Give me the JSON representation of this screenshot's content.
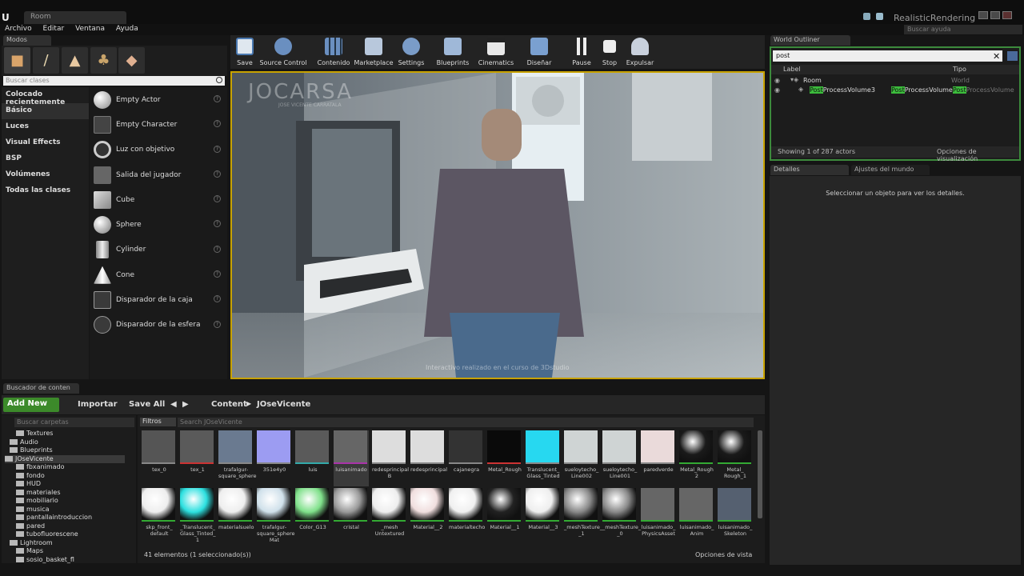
{
  "window": {
    "tab_label": "Room",
    "app_title": "RealisticRendering"
  },
  "menu": [
    "Archivo",
    "Editar",
    "Ventana",
    "Ayuda"
  ],
  "help_search_placeholder": "Buscar ayuda",
  "modes": {
    "tab": "Modos",
    "search_placeholder": "Buscar clases",
    "categories": [
      "Colocado recientemente",
      "Básico",
      "Luces",
      "Visual Effects",
      "BSP",
      "Volúmenes",
      "Todas las clases"
    ],
    "selected_category": "Básico",
    "classes": [
      "Empty Actor",
      "Empty Character",
      "Luz con objetivo",
      "Salida del jugador",
      "Cube",
      "Sphere",
      "Cylinder",
      "Cone",
      "Disparador de la caja",
      "Disparador de la esfera"
    ]
  },
  "toolbar": [
    "Save",
    "Source Control",
    "Contenido",
    "Marketplace",
    "Settings",
    "Blueprints",
    "Cinematics",
    "Diseñar",
    "Pause",
    "Stop",
    "Expulsar"
  ],
  "viewport": {
    "watermark": "JOCARSA",
    "watermark_sub": "JOSE VICENTE CARRATALA",
    "credit": "Interactivo realizado en el curso de 3Dstudio"
  },
  "outliner": {
    "tab": "World Outliner",
    "search_value": "post",
    "col_label": "Label",
    "col_type": "Tipo",
    "rows": [
      {
        "label": "Room",
        "type": "World"
      },
      {
        "label_hl": "Post",
        "label_rest": "ProcessVolume3",
        "type_hl1": "Post",
        "type_mid": "ProcessVolume",
        "type_hl2": "Post",
        "type_rest": "ProcessVolume"
      }
    ],
    "footer": "Showing 1 of 287 actors",
    "view_options": "Opciones de visualización"
  },
  "details": {
    "tab": "Detalles",
    "world_tab": "Ajustes del mundo",
    "message": "Seleccionar un objeto para ver los detalles."
  },
  "content_browser": {
    "tab": "Buscador de conten",
    "add_new": "Add New",
    "import": "Importar",
    "save_all": "Save All",
    "path": [
      "Content",
      "JOseVicente"
    ],
    "folder_search_placeholder": "Buscar carpetas",
    "asset_search_placeholder": "Search JOseVicente",
    "filters": "Filtros",
    "folders": [
      "Textures",
      "Audio",
      "Blueprints",
      "JOseVicente",
      "fbxanimado",
      "fondo",
      "HUD",
      "materiales",
      "mobiliario",
      "musica",
      "pantallaintroduccion",
      "pared",
      "tubofluorescene",
      "Lightroom",
      "Maps",
      "sosio_basket_fl"
    ],
    "assets_row1": [
      "tex_0",
      "tex_1",
      "trafalgur-\nsquare_sphere",
      "351e4y0",
      "luis",
      "luisanimado",
      "redesprincipal\nB",
      "redesprincipal",
      "cajanegra",
      "Metal_Rough",
      "Translucent_\nGlass_Tinted",
      "sueloytecho_\nLine002",
      "sueloytecho_\nLine001",
      "paredverde",
      "Metal_Rough\n2",
      "Metal_\nRough_1"
    ],
    "assets_row2": [
      "skp_front_\ndefault",
      "_Translucent_\nGlass_Tinted_\n1",
      "materialsuelo",
      "trafalgur-\nsquare_sphere\nMat",
      "Color_G13",
      "cristal",
      "_mesh\nUntextured",
      "Material__2",
      "materialtecho",
      "Material__1",
      "Material__3",
      "_meshTexture_\n_1",
      "_meshTexture_\n_0",
      "luisanimado_\nPhysicsAsset",
      "luisanimado_\nAnim",
      "luisanimado_\nSkeleton"
    ],
    "footer": "41 elementos (1 seleccionado(s))",
    "view_options": "Opciones de vista"
  }
}
